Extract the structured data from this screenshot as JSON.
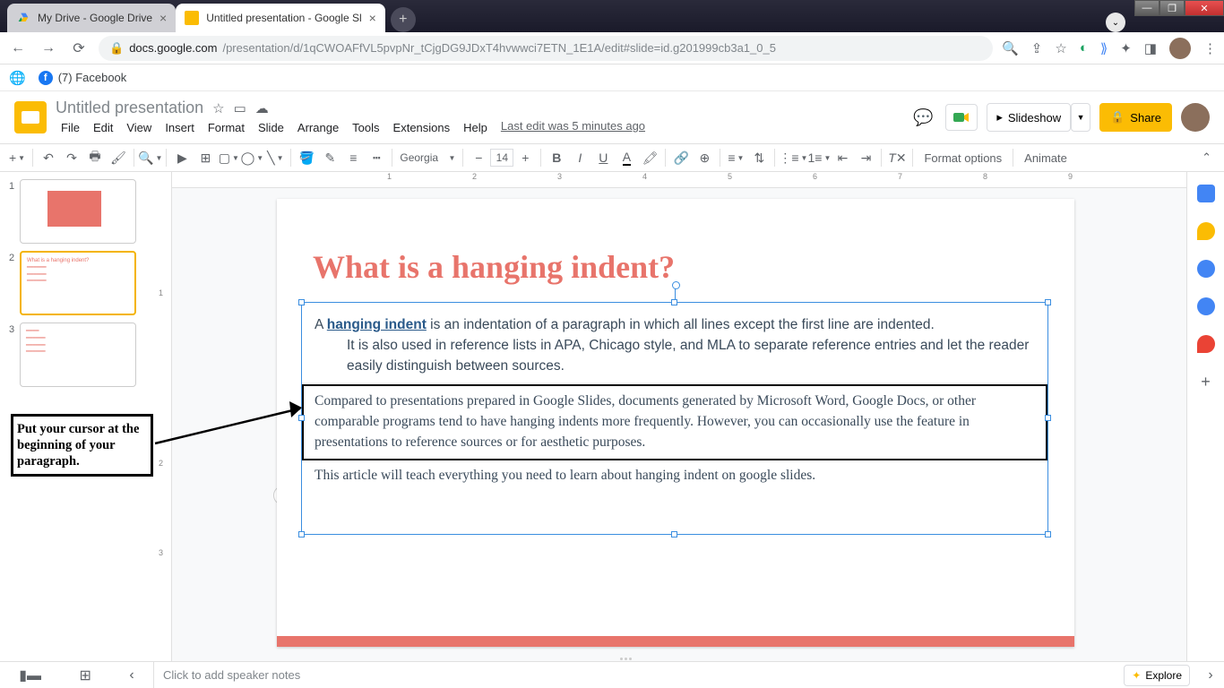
{
  "window": {
    "min": "—",
    "max": "❐",
    "close": "✕"
  },
  "browser": {
    "tabs": [
      {
        "title": "My Drive - Google Drive"
      },
      {
        "title": "Untitled presentation - Google Sl"
      }
    ],
    "url_host": "docs.google.com",
    "url_path": "/presentation/d/1qCWOAFfVL5pvpNr_tCjgDG9JDxT4hvwwci7ETN_1E1A/edit#slide=id.g201999cb3a1_0_5"
  },
  "bookmarks": {
    "fb": "(7) Facebook"
  },
  "app": {
    "title": "Untitled presentation",
    "menus": [
      "File",
      "Edit",
      "View",
      "Insert",
      "Format",
      "Slide",
      "Arrange",
      "Tools",
      "Extensions",
      "Help"
    ],
    "last_edit": "Last edit was 5 minutes ago",
    "slideshow": "Slideshow",
    "share": "Share"
  },
  "toolbar": {
    "font": "Georgia",
    "size": "14",
    "format_options": "Format options",
    "animate": "Animate"
  },
  "ruler_h": [
    "1",
    "2",
    "3",
    "4",
    "5",
    "6",
    "7",
    "8",
    "9"
  ],
  "ruler_v": [
    "1",
    "2",
    "3"
  ],
  "slide": {
    "title": "What is a hanging indent?",
    "p1a": "A ",
    "p1link": "hanging indent",
    "p1b": " is an indentation of a paragraph in which all lines except the first line are indented.",
    "p1c": "It is also used in reference lists in APA, Chicago style, and MLA to separate reference entries and let the reader easily distinguish between sources.",
    "p2": "Compared to presentations prepared in Google Slides, documents generated by Microsoft Word, Google Docs, or other comparable programs tend to have hanging indents more frequently. However, you can occasionally use the feature in presentations to reference sources or for aesthetic purposes.",
    "p3": "This article will teach everything you need to learn about hanging indent on google slides."
  },
  "annotation": "Put your cursor at the beginning of your paragraph.",
  "notes_placeholder": "Click to add speaker notes",
  "explore": "Explore",
  "thumbs": [
    "1",
    "2",
    "3"
  ]
}
